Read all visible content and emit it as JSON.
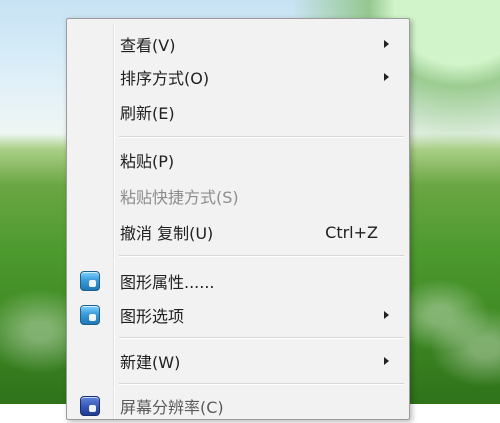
{
  "context_menu": {
    "items": [
      {
        "label": "查看(V)",
        "submenu": true
      },
      {
        "label": "排序方式(O)",
        "submenu": true
      },
      {
        "label": "刷新(E)"
      },
      {
        "label": "粘贴(P)"
      },
      {
        "label": "粘贴快捷方式(S)",
        "disabled": true
      },
      {
        "label": "撤消 复制(U)",
        "shortcut": "Ctrl+Z"
      },
      {
        "label": "图形属性......",
        "icon": "graphics-properties-icon"
      },
      {
        "label": "图形选项",
        "submenu": true,
        "icon": "graphics-options-icon"
      },
      {
        "label": "新建(W)",
        "submenu": true
      },
      {
        "label": "屏幕分辨率(C)",
        "icon": "display-icon",
        "partially_visible": true
      }
    ]
  },
  "colors": {
    "menu_background": "#f2f2f2",
    "menu_border": "#9c9c9c",
    "disabled_text": "#8d8d8d",
    "text": "#202020",
    "sky": "#d6ecf8",
    "grass": "#4d9a2f"
  }
}
